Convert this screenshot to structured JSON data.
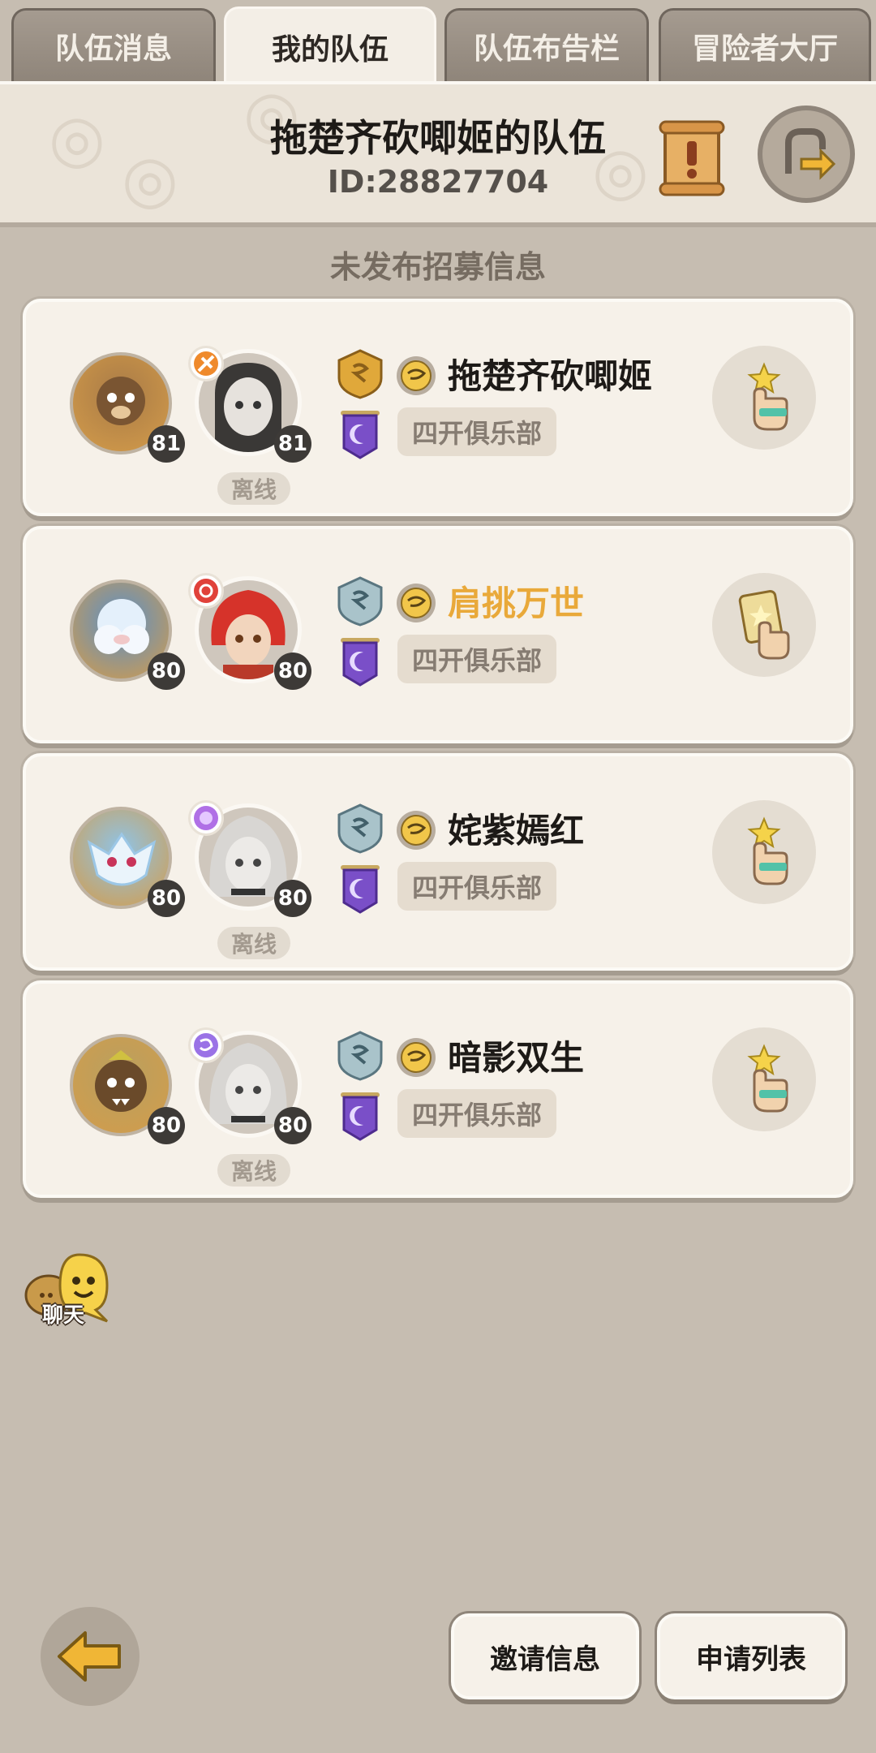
{
  "tabs": [
    {
      "label": "队伍消息"
    },
    {
      "label": "我的队伍"
    },
    {
      "label": "队伍布告栏"
    },
    {
      "label": "冒险者大厅"
    }
  ],
  "header": {
    "team_name": "拖楚齐砍唧姬的队伍",
    "team_id": "ID:28827704"
  },
  "recruit_status": "未发布招募信息",
  "members": [
    {
      "pet_level": "81",
      "hero_level": "81",
      "offline_label": "离线",
      "name": "拖楚齐砍唧姬",
      "name_color": "#1d1a17",
      "guild": "四开俱乐部",
      "rank": "gold",
      "action_icon": "star-hand-icon"
    },
    {
      "pet_level": "80",
      "hero_level": "80",
      "offline_label": "",
      "name": "肩挑万世",
      "name_color": "#e9a93a",
      "guild": "四开俱乐部",
      "rank": "silver",
      "action_icon": "card-hand-icon"
    },
    {
      "pet_level": "80",
      "hero_level": "80",
      "offline_label": "离线",
      "name": "姹紫嫣红",
      "name_color": "#1d1a17",
      "guild": "四开俱乐部",
      "rank": "silver",
      "action_icon": "star-hand-icon"
    },
    {
      "pet_level": "80",
      "hero_level": "80",
      "offline_label": "离线",
      "name": "暗影双生",
      "name_color": "#1d1a17",
      "guild": "四开俱乐部",
      "rank": "silver",
      "action_icon": "star-hand-icon"
    }
  ],
  "chat_label": "聊天",
  "bottom": {
    "invite_label": "邀请信息",
    "apply_label": "申请列表"
  }
}
